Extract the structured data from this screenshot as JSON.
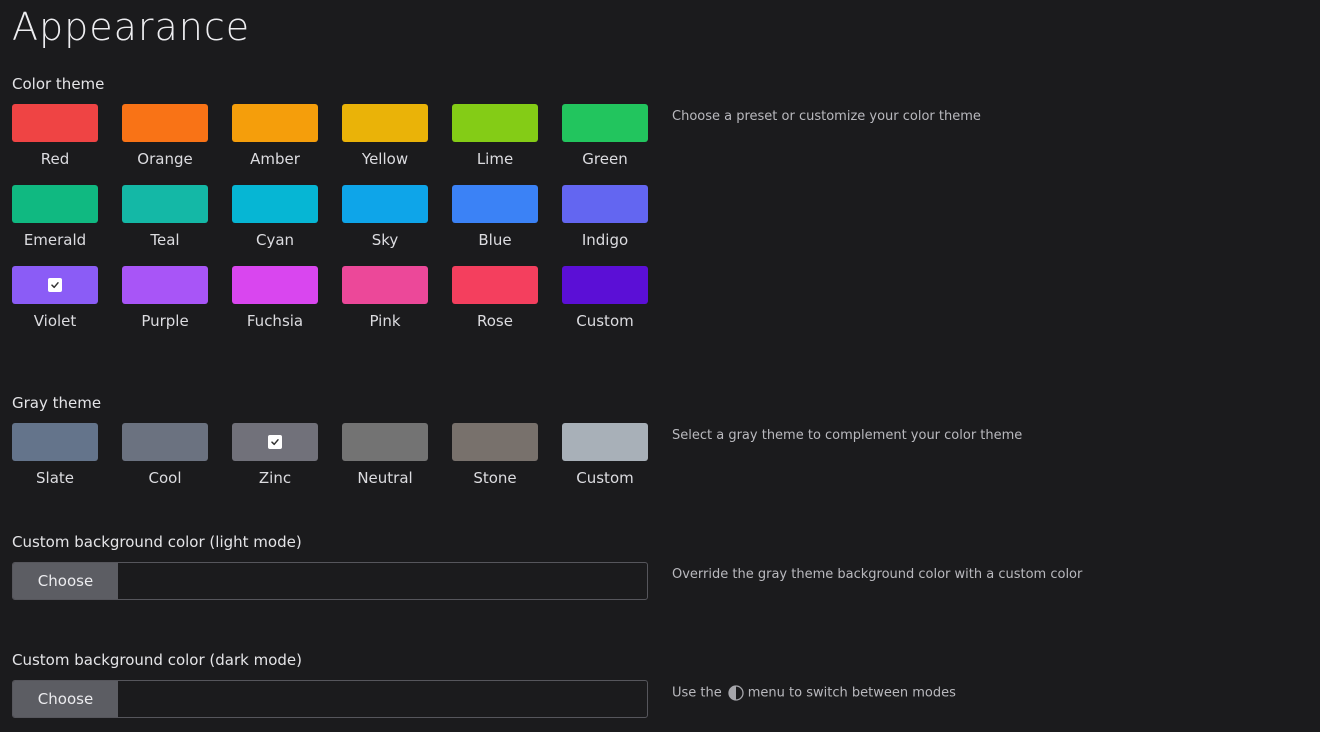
{
  "page": {
    "title": "Appearance"
  },
  "color_theme": {
    "label": "Color theme",
    "hint": "Choose a preset or customize your color theme",
    "selected": "Violet",
    "swatches": [
      {
        "name": "Red",
        "color": "#ef4444"
      },
      {
        "name": "Orange",
        "color": "#f97316"
      },
      {
        "name": "Amber",
        "color": "#f59e0b"
      },
      {
        "name": "Yellow",
        "color": "#eab308"
      },
      {
        "name": "Lime",
        "color": "#84cc16"
      },
      {
        "name": "Green",
        "color": "#22c55e"
      },
      {
        "name": "Emerald",
        "color": "#10b981"
      },
      {
        "name": "Teal",
        "color": "#14b8a6"
      },
      {
        "name": "Cyan",
        "color": "#06b6d4"
      },
      {
        "name": "Sky",
        "color": "#0ea5e9"
      },
      {
        "name": "Blue",
        "color": "#3b82f6"
      },
      {
        "name": "Indigo",
        "color": "#6366f1"
      },
      {
        "name": "Violet",
        "color": "#8b5cf6"
      },
      {
        "name": "Purple",
        "color": "#a855f7"
      },
      {
        "name": "Fuchsia",
        "color": "#d946ef"
      },
      {
        "name": "Pink",
        "color": "#ec4899"
      },
      {
        "name": "Rose",
        "color": "#f43f5e"
      },
      {
        "name": "Custom",
        "color": "#5b0fd6"
      }
    ]
  },
  "gray_theme": {
    "label": "Gray theme",
    "hint": "Select a gray theme to complement your color theme",
    "selected": "Zinc",
    "swatches": [
      {
        "name": "Slate",
        "color": "#64748b"
      },
      {
        "name": "Cool",
        "color": "#6b7280"
      },
      {
        "name": "Zinc",
        "color": "#71717a"
      },
      {
        "name": "Neutral",
        "color": "#737373"
      },
      {
        "name": "Stone",
        "color": "#78716c"
      },
      {
        "name": "Custom",
        "color": "#a8b0b8"
      }
    ]
  },
  "bg_light": {
    "label": "Custom background color (light mode)",
    "button_label": "Choose",
    "hint": "Override the gray theme background color with a custom color"
  },
  "bg_dark": {
    "label": "Custom background color (dark mode)",
    "button_label": "Choose",
    "hint_before": "Use the",
    "hint_icon": "half-circle-contrast-icon",
    "hint_after": "menu to switch between modes"
  }
}
